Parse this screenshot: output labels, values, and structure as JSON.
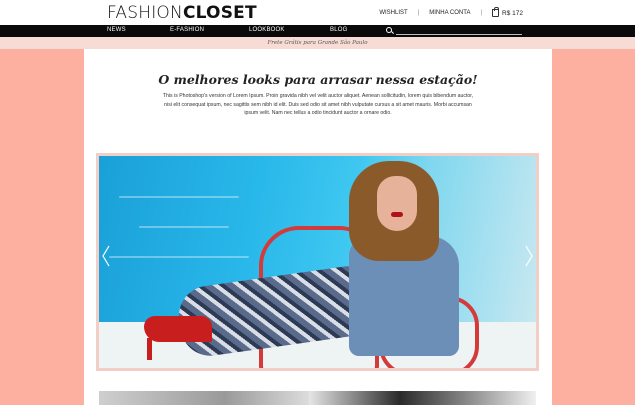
{
  "header": {
    "logo_light": "FASHION",
    "logo_bold": "CLOSET",
    "links": [
      "WISHLIST",
      "MINHA CONTA"
    ],
    "cart_total": "R$ 172"
  },
  "nav": {
    "items": [
      "NEWS",
      "E-FASHION",
      "LOOKBOOK",
      "BLOG"
    ],
    "search_placeholder": ""
  },
  "promo": "Frete Grátis para Grande São Paulo",
  "main": {
    "headline": "O melhores looks para arrasar nessa estação!",
    "intro": "This is Photoshop's version  of Lorem Ipsum. Proin gravida nibh vel velit auctor aliquet. Aenean sollicitudin, lorem quis bibendum auctor, nisi elit consequat ipsum, nec sagittis sem nibh id elit. Duis sed odio sit amet nibh vulputate cursus a sit amet mauris. Morbi accumsan ipsum velit. Nam nec tellus a odio tincidunt auctor a ornare odio."
  },
  "colors": {
    "background": "#fdb0a0",
    "nav": "#0a0a0a",
    "promo": "#f7dcd6",
    "accent_red": "#c81e1e"
  },
  "icons": {
    "search": "search-icon",
    "bag": "shopping-bag-icon",
    "prev": "chevron-left-icon",
    "next": "chevron-right-icon"
  }
}
